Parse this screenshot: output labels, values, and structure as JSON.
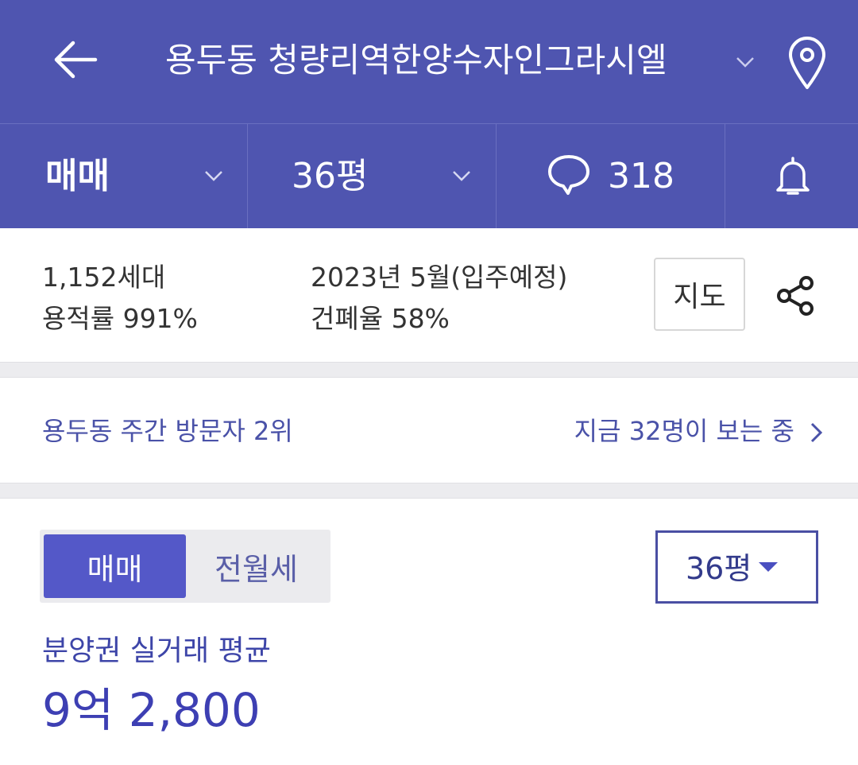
{
  "header": {
    "back_icon": "arrow-left-icon",
    "title": "용두동 청량리역한양수자인그라시엘",
    "dropdown_icon": "chevron-down-icon",
    "map_pin_icon": "map-pin-icon"
  },
  "tabs": {
    "deal_type": "매매",
    "area": "36평",
    "comment_count": "318",
    "comment_icon": "speech-bubble-icon",
    "bell_icon": "bell-icon"
  },
  "info": {
    "households": "1,152세대",
    "floor_area_ratio": "용적률 991%",
    "move_in": "2023년 5월(입주예정)",
    "coverage_ratio": "건폐율 58%",
    "map_button": "지도",
    "share_icon": "share-icon"
  },
  "visitors": {
    "rank": "용두동 주간 방문자 2위",
    "watching": "지금 32명이 보는 중"
  },
  "price": {
    "segment_sale": "매매",
    "segment_rent": "전월세",
    "size_select": "36평",
    "label": "분양권 실거래 평균",
    "value": "9억 2,800"
  },
  "colors": {
    "brand": "#4f55b0",
    "accent": "#5458c8",
    "link": "#4a52a8"
  }
}
